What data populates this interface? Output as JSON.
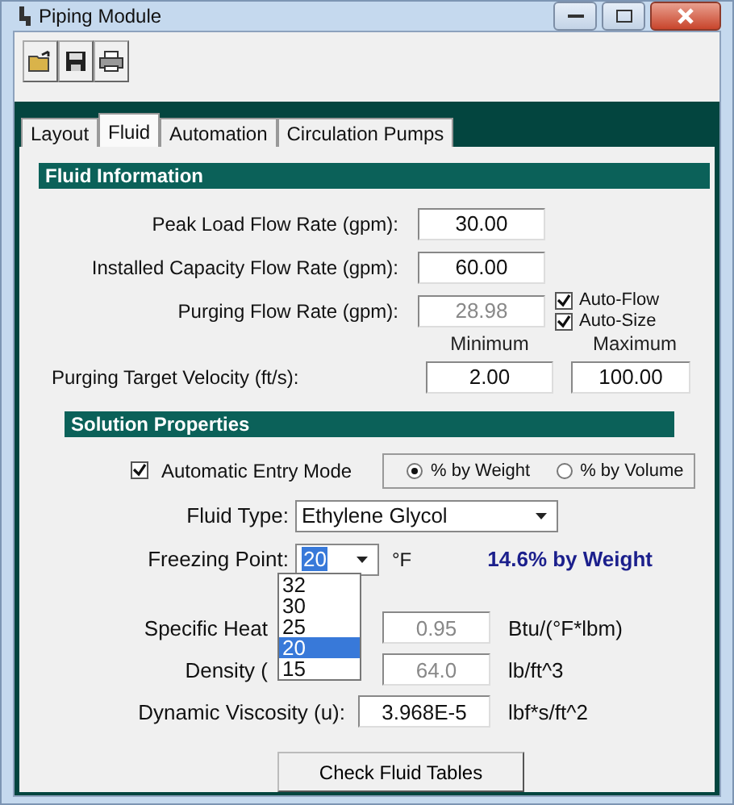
{
  "window": {
    "title": "Piping Module"
  },
  "tabs": [
    {
      "label": "Layout",
      "selected": false
    },
    {
      "label": "Fluid",
      "selected": true
    },
    {
      "label": "Automation",
      "selected": false
    },
    {
      "label": "Circulation Pumps",
      "selected": false
    }
  ],
  "fluid_information": {
    "title": "Fluid Information",
    "rows": [
      {
        "label": "Peak Load Flow Rate (gpm):",
        "value": "30.00",
        "disabled": false
      },
      {
        "label": "Installed Capacity Flow Rate (gpm):",
        "value": "60.00",
        "disabled": false
      },
      {
        "label": "Purging Flow Rate (gpm):",
        "value": "28.98",
        "disabled": true
      }
    ],
    "options": [
      {
        "label": "Auto-Flow",
        "checked": true
      },
      {
        "label": "Auto-Size",
        "checked": true
      }
    ],
    "velocity": {
      "label": "Purging Target Velocity (ft/s):",
      "minimum_label": "Minimum",
      "maximum_label": "Maximum",
      "minimum": "2.00",
      "maximum": "100.00"
    }
  },
  "solution_properties": {
    "title": "Solution Properties",
    "automatic_entry": {
      "label": "Automatic Entry Mode",
      "checked": true
    },
    "basis": [
      {
        "label": "% by Weight",
        "selected": true
      },
      {
        "label": "% by Volume",
        "selected": false
      }
    ],
    "fluid_type": {
      "label": "Fluid Type:",
      "value": "Ethylene Glycol"
    },
    "freezing_point": {
      "label": "Freezing Point:",
      "value": "20",
      "unit": "°F",
      "result": "14.6% by Weight"
    },
    "freezing_options": [
      {
        "label": "32",
        "selected": false
      },
      {
        "label": "30",
        "selected": false
      },
      {
        "label": "25",
        "selected": false
      },
      {
        "label": "20",
        "selected": true
      },
      {
        "label": "15",
        "selected": false
      }
    ],
    "properties": [
      {
        "label": "Specific Heat",
        "value": "0.95",
        "unit": "Btu/(°F*lbm)",
        "disabled": true
      },
      {
        "label": "Density (",
        "value": "64.0",
        "unit": "lb/ft^3",
        "disabled": true
      },
      {
        "label": "Dynamic Viscosity (u):",
        "value": "3.968E-5",
        "unit": "lbf*s/ft^2",
        "disabled": false
      }
    ],
    "button": "Check Fluid Tables"
  }
}
